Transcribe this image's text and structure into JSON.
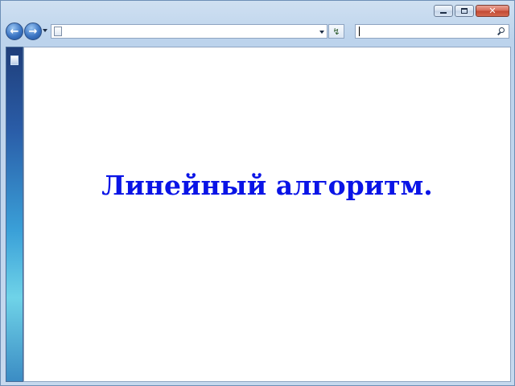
{
  "window": {
    "caption_buttons": {
      "minimize_icon": "minimize-icon",
      "maximize_icon": "maximize-icon",
      "close_icon": "close-icon",
      "close_glyph": "✕"
    }
  },
  "toolbar": {
    "back_icon": "back-arrow-icon",
    "back_glyph": "←",
    "forward_icon": "forward-arrow-icon",
    "forward_glyph": "→",
    "address_value": "",
    "search_value": "",
    "refresh_glyph": "↯"
  },
  "content": {
    "title": "Линейный алгоритм.",
    "title_color": "#0a14e6"
  }
}
